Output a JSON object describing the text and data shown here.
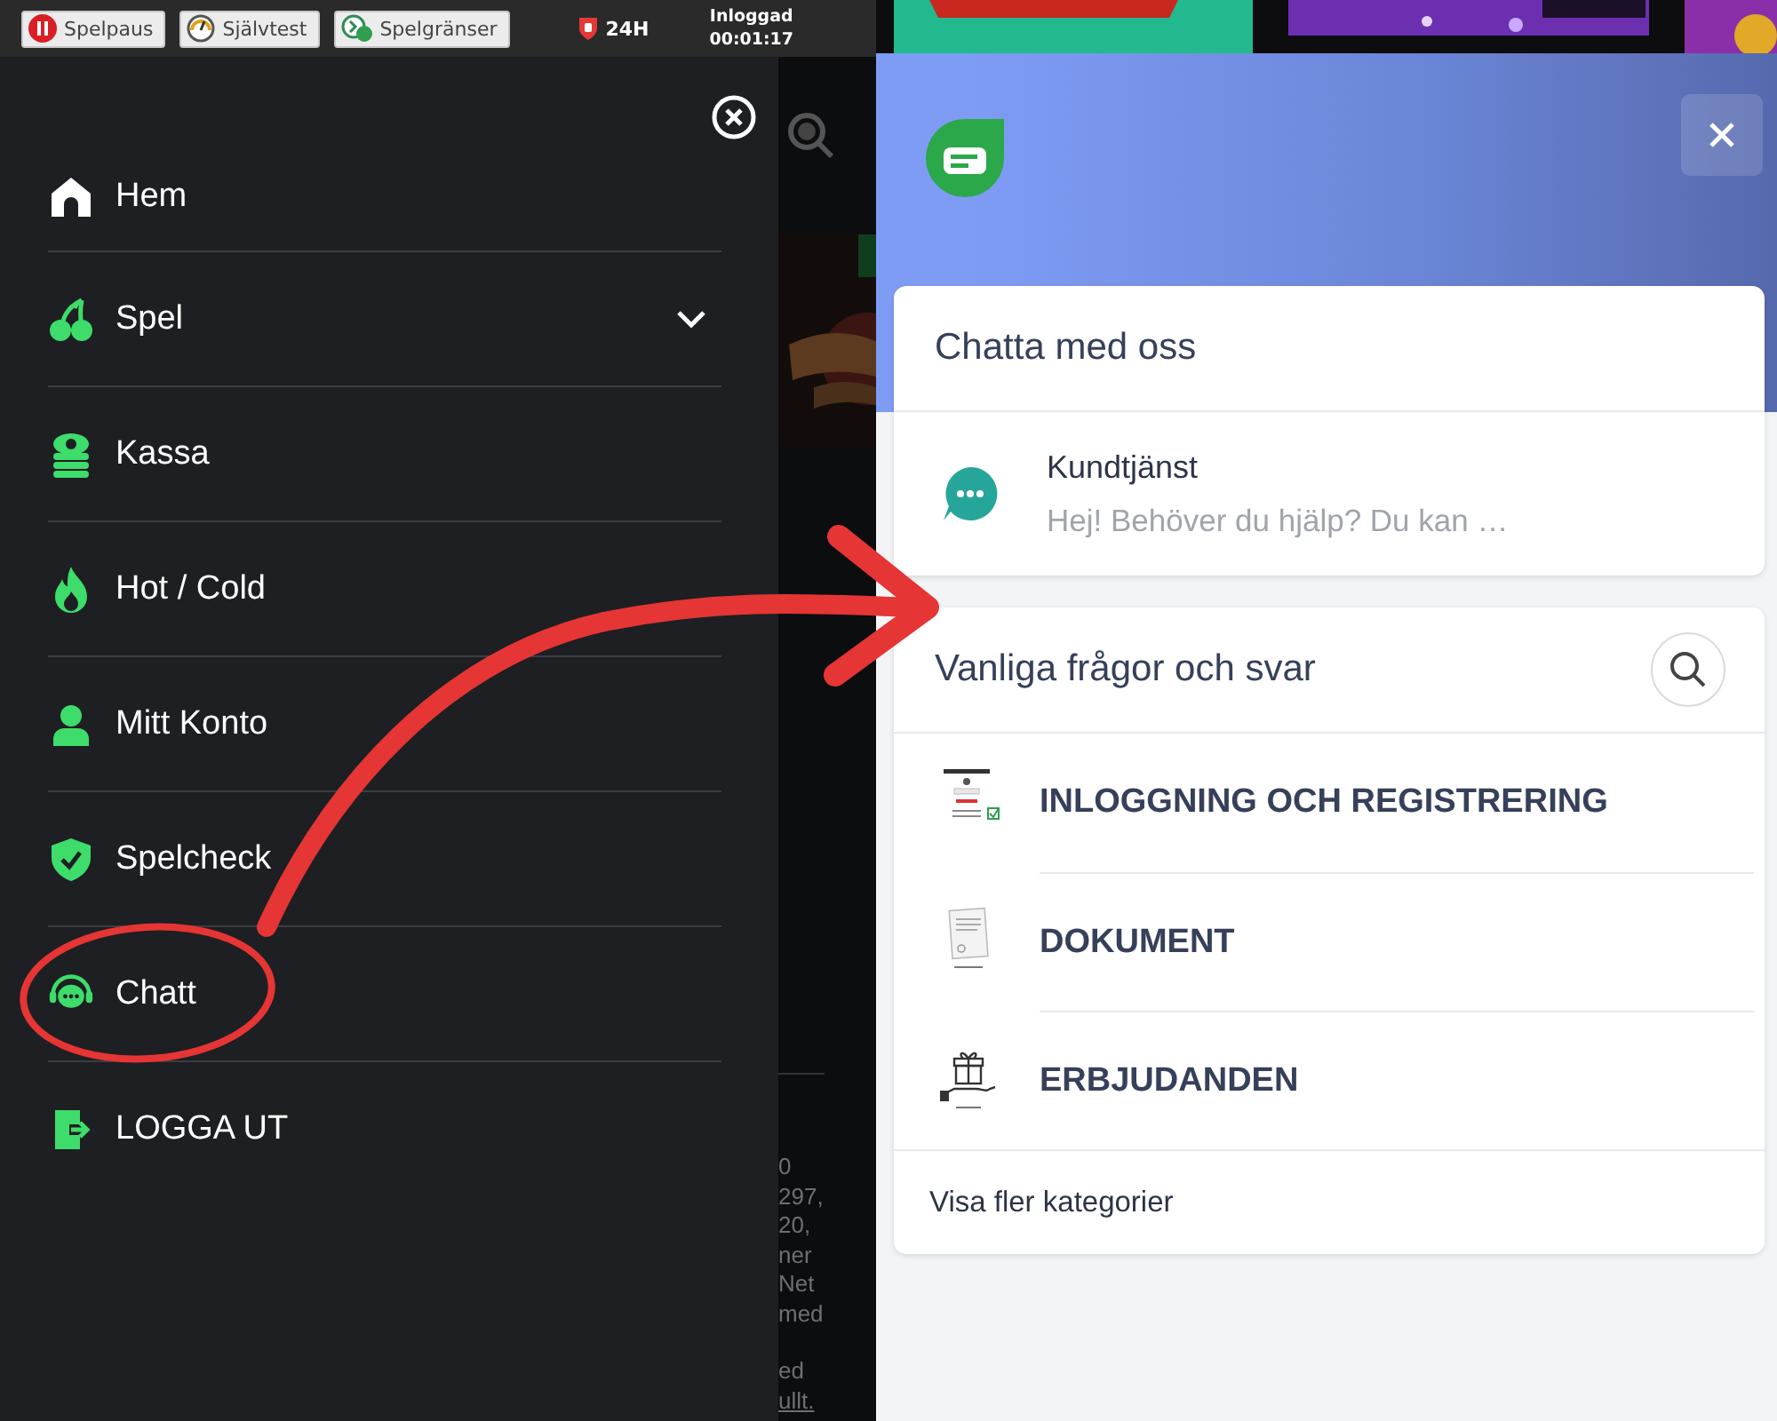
{
  "top_bar": {
    "buttons": [
      {
        "label": "Spelpaus"
      },
      {
        "label": "Självtest"
      },
      {
        "label": "Spelgränser"
      }
    ],
    "session_limit": "24H",
    "status_label": "Inloggad",
    "session_time": "00:01:17"
  },
  "menu": {
    "items": [
      {
        "label": "Hem",
        "submenu": false
      },
      {
        "label": "Spel",
        "submenu": true
      },
      {
        "label": "Kassa",
        "submenu": false
      },
      {
        "label": "Hot / Cold",
        "submenu": false
      },
      {
        "label": "Mitt Konto",
        "submenu": false
      },
      {
        "label": "Spelcheck",
        "submenu": false
      },
      {
        "label": "Chatt",
        "submenu": false
      },
      {
        "label": "LOGGA UT",
        "submenu": false
      }
    ]
  },
  "background_text": [
    "0",
    "297,",
    "20,",
    "ner",
    "Net",
    "med",
    "ed",
    "ullt."
  ],
  "chat_panel": {
    "contact_card": {
      "title": "Chatta med oss",
      "conversation": {
        "name": "Kundtjänst",
        "preview": "Hej! Behöver du hjälp? Du kan …"
      }
    },
    "faq_card": {
      "title": "Vanliga frågor och svar",
      "categories": [
        {
          "label": "INLOGGNING OCH REGISTRERING"
        },
        {
          "label": "DOKUMENT"
        },
        {
          "label": "ERBJUDANDEN"
        }
      ],
      "more_link": "Visa fler kategorier"
    }
  }
}
